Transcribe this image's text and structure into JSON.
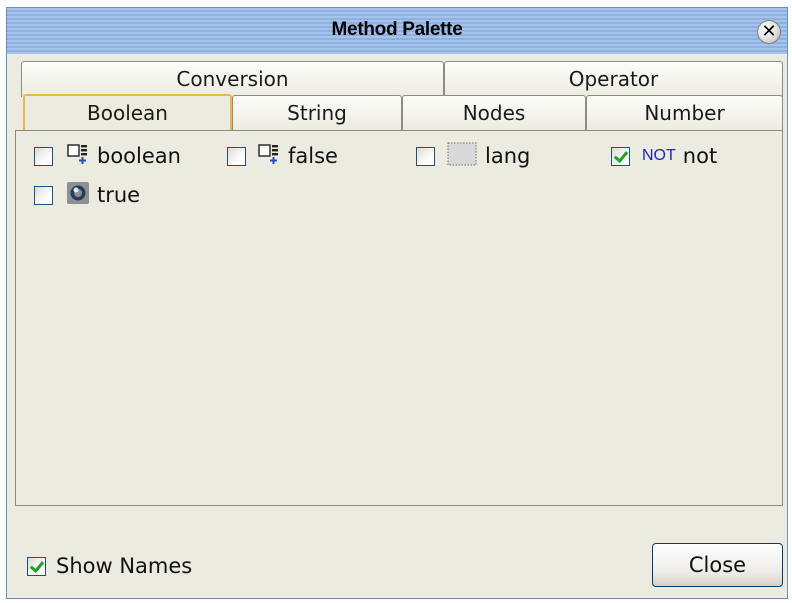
{
  "window": {
    "title": "Method Palette"
  },
  "tabs": {
    "row1": [
      {
        "label": "Conversion"
      },
      {
        "label": "Operator"
      }
    ],
    "row2": [
      {
        "label": "Boolean",
        "active": true
      },
      {
        "label": "String"
      },
      {
        "label": "Nodes"
      },
      {
        "label": "Number"
      }
    ]
  },
  "methods": [
    {
      "label": "boolean",
      "checked": false,
      "icon": "grid-plus-icon"
    },
    {
      "label": "false",
      "checked": false,
      "icon": "grid-plus-icon"
    },
    {
      "label": "lang",
      "checked": false,
      "icon": "dotted-box-icon"
    },
    {
      "label": "not",
      "checked": true,
      "icon": "not-text-icon",
      "icon_text": "NOT"
    },
    {
      "label": "true",
      "checked": false,
      "icon": "circle-badge-icon"
    }
  ],
  "footer": {
    "show_names_label": "Show Names",
    "show_names_checked": true,
    "close_label": "Close"
  },
  "colors": {
    "title_bg": "#a6c3ec",
    "panel_bg": "#ecebe0",
    "active_tab_border": "#e7b84c",
    "not_icon": "#2020c8"
  }
}
